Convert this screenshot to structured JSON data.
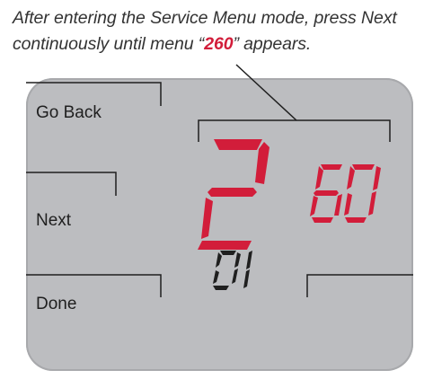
{
  "instruction": {
    "line1": "After entering the Service Menu mode, press Next",
    "line2_before": "continuously until menu “",
    "line2_highlight": "260",
    "line2_after": "” appears."
  },
  "buttons": {
    "go_back": "Go Back",
    "next": "Next",
    "done": "Done"
  },
  "display": {
    "menu_number": "260",
    "menu_digit_large": "2",
    "menu_digits_small": "60",
    "option_value": "01"
  },
  "colors": {
    "accent": "#d21d3a",
    "lcd_background": "#bcbdc0",
    "segment_dark": "#1f1f1f"
  }
}
